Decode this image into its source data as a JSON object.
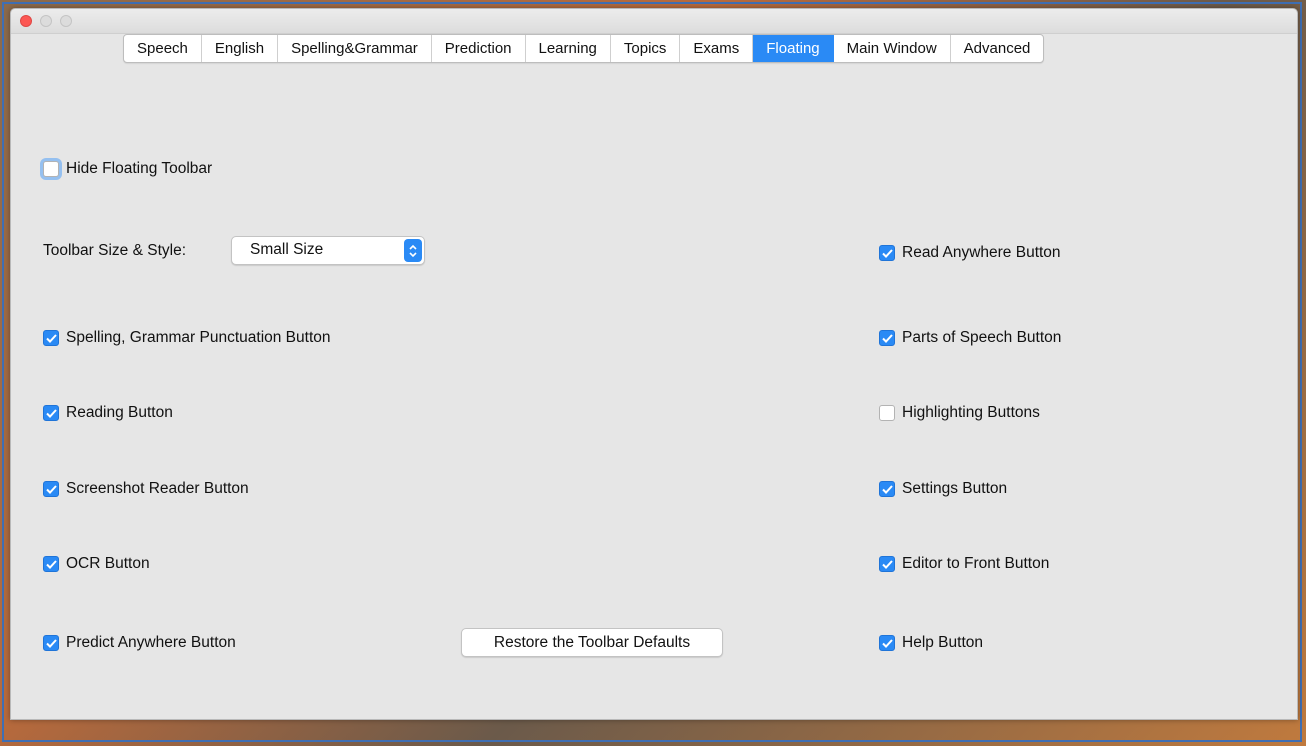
{
  "tabs": [
    {
      "label": "Speech"
    },
    {
      "label": "English"
    },
    {
      "label": "Spelling&Grammar"
    },
    {
      "label": "Prediction"
    },
    {
      "label": "Learning"
    },
    {
      "label": "Topics"
    },
    {
      "label": "Exams"
    },
    {
      "label": "Floating",
      "active": true
    },
    {
      "label": "Main Window"
    },
    {
      "label": "Advanced"
    }
  ],
  "hide_toolbar": {
    "label": "Hide Floating Toolbar",
    "checked": false
  },
  "toolbar_size": {
    "label": "Toolbar Size & Style:",
    "value": "Small Size"
  },
  "left_options": [
    {
      "label": "Spelling, Grammar  Punctuation Button",
      "checked": true
    },
    {
      "label": "Reading Button",
      "checked": true
    },
    {
      "label": "Screenshot Reader Button",
      "checked": true
    },
    {
      "label": "OCR Button",
      "checked": true
    },
    {
      "label": "Predict Anywhere Button",
      "checked": true
    }
  ],
  "right_options": [
    {
      "label": "Read Anywhere Button",
      "checked": true
    },
    {
      "label": "Parts of Speech Button",
      "checked": true
    },
    {
      "label": "Highlighting Buttons",
      "checked": false
    },
    {
      "label": "Settings Button",
      "checked": true
    },
    {
      "label": "Editor to Front Button",
      "checked": true
    },
    {
      "label": "Help Button",
      "checked": true
    }
  ],
  "restore_button": {
    "label": "Restore the Toolbar Defaults"
  },
  "colors": {
    "accent": "#2a8af5",
    "window_bg": "#e6e6e6",
    "close_light": "#fc5753"
  }
}
